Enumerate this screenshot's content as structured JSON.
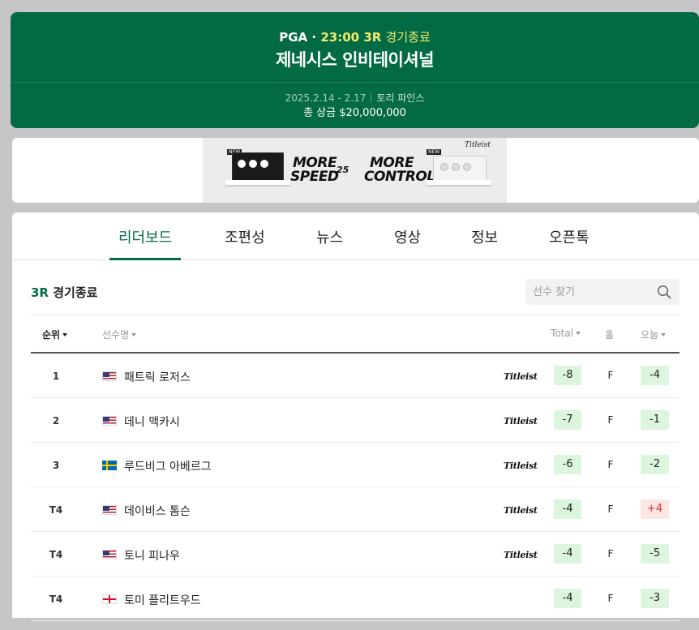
{
  "header": {
    "league": "PGA",
    "dot": " · ",
    "time": "23:00",
    "round": "3R",
    "status": "경기종료",
    "title": "제네시스 인비테이셔널",
    "dates": "2025.2.14 - 2.17",
    "venue": "토리 파인스",
    "purse": "총 상금 $20,000,000"
  },
  "banner": {
    "line1a": "MORE",
    "line1b": "SPEED",
    "mid": "25",
    "line2a": "MORE",
    "line2b": "CONTROL",
    "brand": "Titleist",
    "tag": "NEW"
  },
  "tabs": [
    {
      "label": "리더보드",
      "active": true
    },
    {
      "label": "조편성"
    },
    {
      "label": "뉴스"
    },
    {
      "label": "영상"
    },
    {
      "label": "정보"
    },
    {
      "label": "오픈톡"
    }
  ],
  "leaderboard": {
    "round": "3R",
    "status": "경기종료",
    "search_placeholder": "선수 찾기",
    "headers": {
      "rank": "순위",
      "player": "선수명",
      "total": "Total",
      "hole": "홀",
      "today": "오늘"
    },
    "rows": [
      {
        "rank": "1",
        "country": "us",
        "name": "패트릭 로저스",
        "sponsor": "Titleist",
        "total": "-8",
        "hole": "F",
        "today": "-4",
        "today_type": "under"
      },
      {
        "rank": "2",
        "country": "us",
        "name": "데니 맥카시",
        "sponsor": "Titleist",
        "total": "-7",
        "hole": "F",
        "today": "-1",
        "today_type": "under"
      },
      {
        "rank": "3",
        "country": "se",
        "name": "루드비그 아베르그",
        "sponsor": "Titleist",
        "total": "-6",
        "hole": "F",
        "today": "-2",
        "today_type": "under"
      },
      {
        "rank": "T4",
        "country": "us",
        "name": "데이비스 톰슨",
        "sponsor": "Titleist",
        "total": "-4",
        "hole": "F",
        "today": "+4",
        "today_type": "over"
      },
      {
        "rank": "T4",
        "country": "us",
        "name": "토니 피나우",
        "sponsor": "Titleist",
        "total": "-4",
        "hole": "F",
        "today": "-5",
        "today_type": "under"
      },
      {
        "rank": "T4",
        "country": "en",
        "name": "토미 플리트우드",
        "sponsor": "",
        "total": "-4",
        "hole": "F",
        "today": "-3",
        "today_type": "under"
      }
    ]
  },
  "colors": {
    "brand_green": "#036b43",
    "highlight_yellow": "#f2ea6c",
    "under_par_bg": "#dbf6dc",
    "over_par_bg": "#fde6e2",
    "over_par_text": "#dd3333"
  }
}
